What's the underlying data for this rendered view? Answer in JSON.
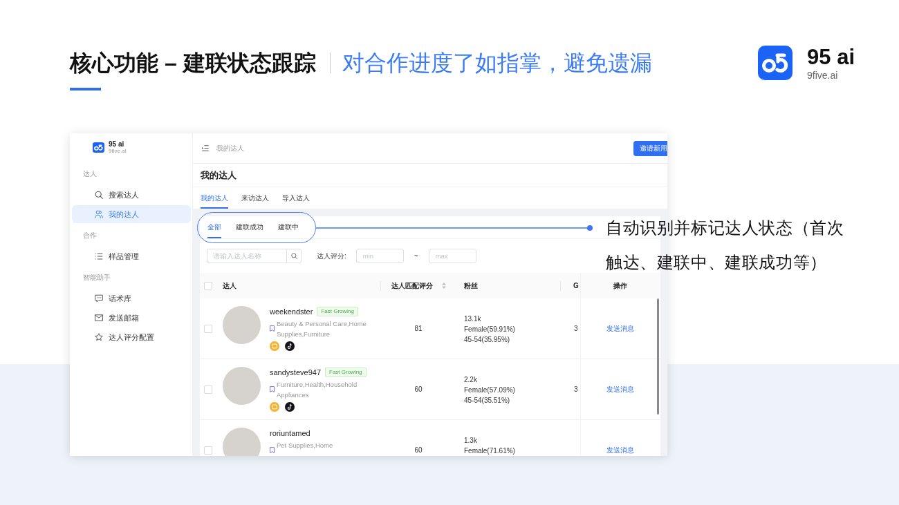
{
  "header": {
    "title": "核心功能 – 建联状态跟踪",
    "subtitle": "对合作进度了如指掌，避免遗漏"
  },
  "brand": {
    "name": "95 ai",
    "domain": "9five.ai"
  },
  "app": {
    "sidebar": {
      "brand": {
        "name": "95 ai",
        "domain": "9five.ai"
      },
      "sections": [
        {
          "label": "达人",
          "items": [
            {
              "kind": "search",
              "label": "搜索达人",
              "selected": false
            },
            {
              "kind": "people",
              "label": "我的达人",
              "selected": true
            }
          ]
        },
        {
          "label": "合作",
          "items": [
            {
              "kind": "list",
              "label": "样品管理",
              "selected": false
            }
          ]
        },
        {
          "label": "智能助手",
          "items": [
            {
              "kind": "chat",
              "label": "话术库",
              "selected": false
            },
            {
              "kind": "mail",
              "label": "发送邮箱",
              "selected": false
            },
            {
              "kind": "star",
              "label": "达人评分配置",
              "selected": false
            }
          ]
        }
      ]
    },
    "top_bar": {
      "breadcrumb": "我的达人",
      "button": "邀请新用"
    },
    "page_title": "我的达人",
    "tabs": [
      {
        "label": "我的达人",
        "selected": true
      },
      {
        "label": "来访达人",
        "selected": false
      },
      {
        "label": "导入达人",
        "selected": false
      }
    ],
    "status_tabs": [
      {
        "label": "全部",
        "selected": true
      },
      {
        "label": "建联成功",
        "selected": false
      },
      {
        "label": "建联中",
        "selected": false
      }
    ],
    "filters": {
      "search": {
        "placeholder": "请输入达人名称"
      },
      "score_label": "达人评分:",
      "min": {
        "placeholder": "min"
      },
      "separator": "~",
      "max": {
        "placeholder": "max"
      }
    },
    "table": {
      "select_all_checked": false,
      "columns": [
        {
          "label": "达人",
          "sortable": false
        },
        {
          "label": "达人匹配评分",
          "sortable": true
        },
        {
          "label": "粉丝",
          "sortable": false
        },
        {
          "label": "G",
          "sortable": false
        },
        {
          "label": "操作",
          "sortable": false
        }
      ],
      "rows": [
        {
          "checked": false,
          "name": "weekendster",
          "tag": "Fast Growing",
          "category": "Beauty & Personal Care,Home Supplies,Furniture",
          "platforms": [
            {
              "kind": "shop"
            },
            {
              "kind": "tiktok"
            }
          ],
          "score": "81",
          "followers": [
            "13.1k",
            "Female(59.91%)",
            "45-54(35.95%)"
          ],
          "column_4": "3",
          "action": "发送消息"
        },
        {
          "checked": false,
          "name": "sandysteve947",
          "tag": "Fast Growing",
          "category": "Furniture,Health,Household Appliances",
          "platforms": [
            {
              "kind": "shop"
            },
            {
              "kind": "tiktok"
            }
          ],
          "score": "60",
          "followers": [
            "2.2k",
            "Female(57.09%)",
            "45-54(35.51%)"
          ],
          "column_4": "3",
          "action": "发送消息"
        },
        {
          "checked": false,
          "name": "roriuntamed",
          "category": "Pet Supplies,Home",
          "score": "60",
          "followers": [
            "1.3k",
            "Female(71.61%)"
          ],
          "action": "发送消息"
        }
      ]
    }
  },
  "annotation": {
    "text": "自动识别并标记达人状态（首次触达、建联中、建联成功等）"
  }
}
